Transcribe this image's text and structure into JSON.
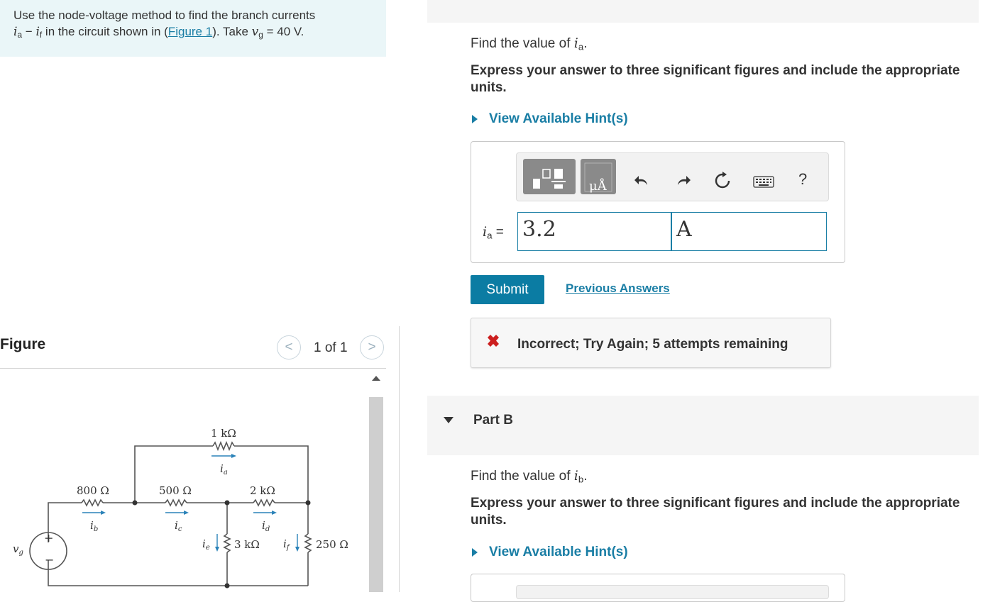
{
  "problem": {
    "line1": "Use the node-voltage method to find the branch currents",
    "var_a": "i",
    "sub_a": "a",
    "dash": " − ",
    "var_f": "i",
    "sub_f": "f",
    "mid": " in the circuit shown in (",
    "link": "Figure 1",
    "after_link": "). Take ",
    "var_g": "v",
    "sub_g": "g",
    "value": " = 40 V."
  },
  "figure": {
    "label": "Figure",
    "page_count": "1 of 1",
    "prev": "<",
    "next": ">",
    "circuit_labels": {
      "r_top": "1 kΩ",
      "i_a": "i",
      "i_a_sub": "a",
      "r_800": "800 Ω",
      "r_500": "500 Ω",
      "r_2k": "2 kΩ",
      "i_b": "i",
      "i_b_sub": "b",
      "i_c": "i",
      "i_c_sub": "c",
      "i_d": "i",
      "i_d_sub": "d",
      "i_e": "i",
      "i_e_sub": "e",
      "i_f": "i",
      "i_f_sub": "f",
      "r_3k": "3 kΩ",
      "r_250": "250 Ω",
      "v_g": "v",
      "v_g_sub": "g",
      "plus": "+",
      "minus": "−"
    }
  },
  "part_a": {
    "question_prefix": "Find the value of ",
    "question_var": "i",
    "question_sub": "a",
    "question_suffix": ".",
    "instruction": "Express your answer to three significant figures and include the appropriate units.",
    "hint": "View Available Hint(s)",
    "answer_var": "i",
    "answer_sub": "a",
    "equals": " =",
    "value": "3.2",
    "unit": "A",
    "units_btn_text": "μÅ",
    "help": "?",
    "submit": "Submit",
    "previous_answers": "Previous Answers",
    "feedback": "Incorrect; Try Again; 5 attempts remaining"
  },
  "part_b": {
    "title": "Part B",
    "question_prefix": "Find the value of ",
    "question_var": "i",
    "question_sub": "b",
    "question_suffix": ".",
    "instruction": "Express your answer to three significant figures and include the appropriate units.",
    "hint": "View Available Hint(s)"
  },
  "colors": {
    "accent": "#1a7ea5",
    "submit": "#0b7ca3",
    "error": "#cc1f1f",
    "problem_bg": "#eaf6f8"
  }
}
